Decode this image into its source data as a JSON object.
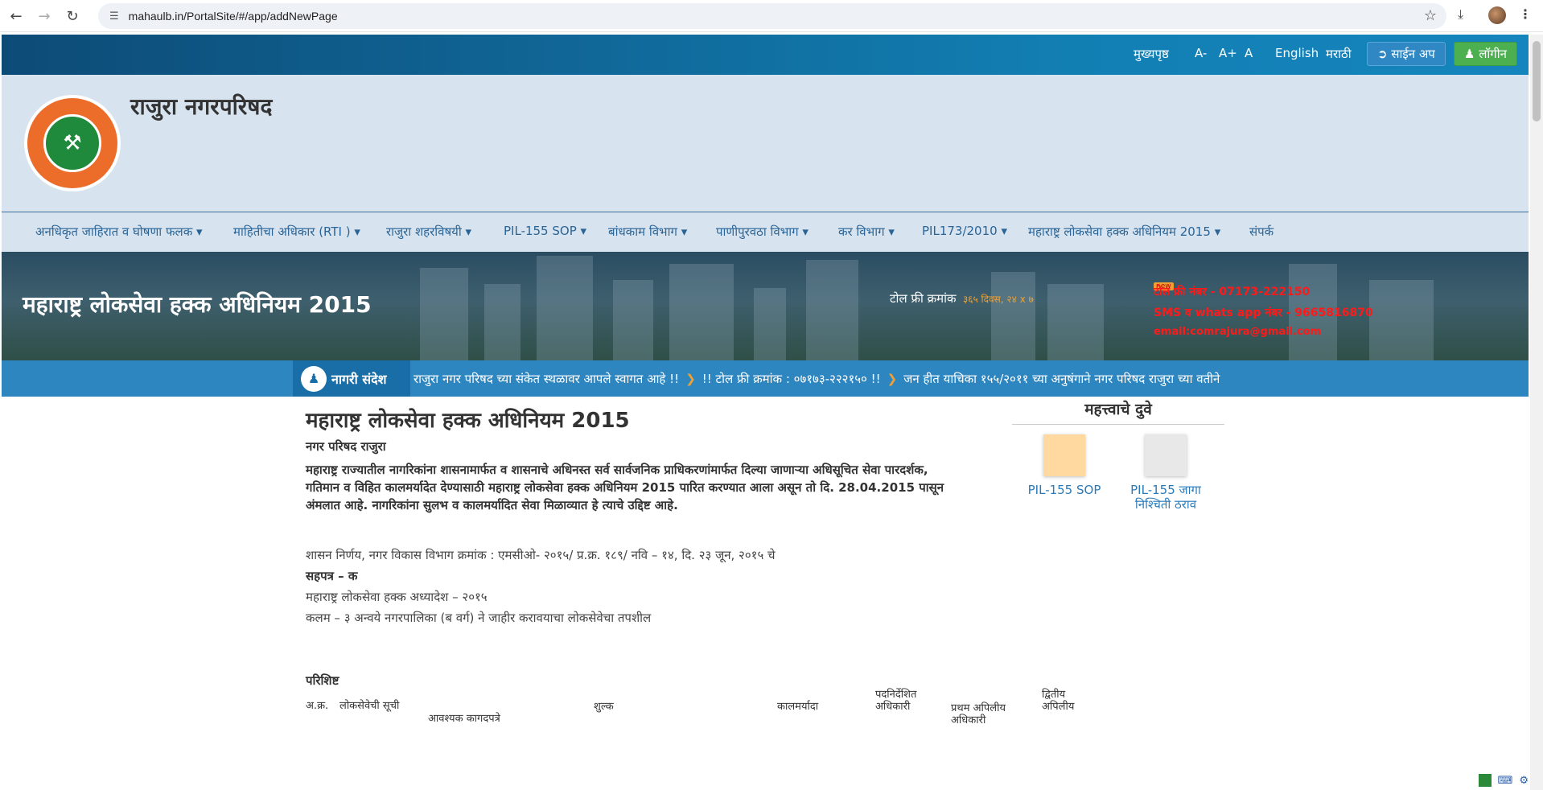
{
  "browser": {
    "url": "mahaulb.in/PortalSite/#/app/addNewPage"
  },
  "topbar": {
    "home": "मुख्यपृष्ठ",
    "font_decrease": "A-",
    "font_increase": "A+",
    "font_reset": "A",
    "lang_english": "English",
    "lang_marathi": "मराठी",
    "signup": "साईन अप",
    "login": "लॉगीन"
  },
  "header": {
    "site_title": "राजुरा नगरपरिषद"
  },
  "menu": {
    "items": [
      "अनधिकृत जाहिरात व घोषणा फलक",
      "माहितीचा अधिकार (RTI )",
      "राजुरा शहरविषयी",
      "PIL-155 SOP",
      "बांधकाम विभाग",
      "पाणीपुरवठा विभाग",
      "कर विभाग",
      "PIL173/2010",
      "महाराष्ट्र लोकसेवा हक्क अधिनियम 2015",
      "संपर्क"
    ]
  },
  "banner": {
    "title": "महाराष्ट्र लोकसेवा हक्क अधिनियम 2015",
    "tollfree_label": "टोल फ्री क्रमांक",
    "tollfree_value": "३६५ दिवस, २४ x ७",
    "new_badge": "new",
    "contact_tollfree": "टोल फ्री नंबर - 07173-222150",
    "contact_sms": "SMS व whats app नंबर - 9665816870",
    "contact_email": "email:comrajura@gmail.com"
  },
  "ticker": {
    "label": "नागरी संदेश",
    "messages": [
      "राजुरा नगर परिषद च्या संकेत स्थळावर आपले स्वागत आहे !!",
      "!! टोल फ्री क्रमांक : ०७१७३-२२२१५० !!",
      "जन हीत याचिका १५५/२०११ च्या अनुषंगाने नगर परिषद राजुरा च्या वतीने"
    ]
  },
  "content": {
    "heading": "महाराष्ट्र लोकसेवा हक्क अधिनियम 2015",
    "org": "नगर परिषद राजुरा",
    "intro": "महाराष्ट्र राज्यातील नागरिकांना शासनामार्फत व शासनाचे अधिनस्त सर्व सार्वजनिक प्राधिकरणांमार्फत दिल्या जाणाऱ्या अधिसूचित सेवा पारदर्शक, गतिमान व विहित कालमर्यादेत देण्यासाठी महाराष्ट्र लोकसेवा हक्क अधिनियम 2015 पारित करण्यात आला असून तो दि. 28.04.2015 पासून अंमलात आहे. नागरिकांना सुलभ व कालमर्यादित सेवा मिळाव्यात हे त्याचे उद्दिष्ट आहे.",
    "gr": "शासन निर्णय, नगर विकास विभाग क्रमांक : एमसीओ- २०१५/ प्र.क्र. १८९/ नवि – १४, दि. २३ जून, २०१५ चे",
    "annex": "सहपत्र – क",
    "ordinance": "महाराष्ट्र लोकसेवा हक्क अध्यादेश – २०१५",
    "section": "कलम – ३ अन्वये नगरपालिका (ब वर्ग) ने जाहीर करावयाचा लोकसेवेचा तपशील",
    "appendix": "परिशिष्ट",
    "table_headers": {
      "sr": "अ.क्र.",
      "service_list": "लोकसेवेची सूची",
      "documents": "आवश्यक कागदपत्रे",
      "fee": "शुल्क",
      "time_limit": "कालमर्यादा",
      "officer": "पदनिर्देशित अधिकारी",
      "first_appeal": "प्रथम अपिलीय अधिकारी",
      "second_appeal": "द्वितीय अपिलीय"
    }
  },
  "important_links": {
    "title": "महत्त्वाचे दुवे",
    "links": [
      {
        "label": "PIL-155 SOP",
        "color": "#ffd9a0"
      },
      {
        "label": "PIL-155 जागा निश्चिती ठराव",
        "color": "#e8e8e8"
      }
    ]
  },
  "colors": {
    "topbar": "#127fb3",
    "header_bg": "#d7e4ef",
    "ticker": "#2e86c1",
    "login": "#4cb050",
    "link": "#2a6496"
  }
}
